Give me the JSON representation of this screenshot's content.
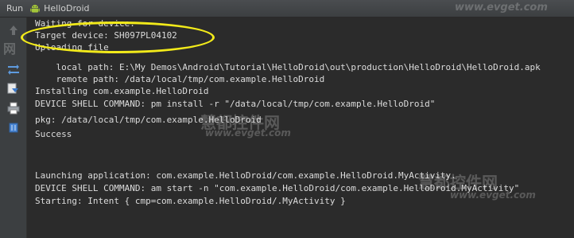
{
  "header": {
    "run_label": "Run",
    "config_name": "HelloDroid"
  },
  "toolbar": {
    "buttons": [
      {
        "icon": "up-arrow-icon"
      },
      {
        "icon": "rerun-icon"
      },
      {
        "icon": "scroll-to-end-icon"
      },
      {
        "icon": "print-icon"
      },
      {
        "icon": "clear-all-icon"
      }
    ]
  },
  "console": {
    "lines": [
      "Waiting for device.",
      "Target device: SH097PL04102",
      "Uploading file",
      "    local path: E:\\My Demos\\Android\\Tutorial\\HelloDroid\\out\\production\\HelloDroid\\HelloDroid.apk",
      "    remote path: /data/local/tmp/com.example.HelloDroid",
      "Installing com.example.HelloDroid",
      "DEVICE SHELL COMMAND: pm install -r \"/data/local/tmp/com.example.HelloDroid\"",
      "pkg: /data/local/tmp/com.example.HelloDroid",
      "Success",
      "",
      "",
      "Launching application: com.example.HelloDroid/com.example.HelloDroid.MyActivity.",
      "DEVICE SHELL COMMAND: am start -n \"com.example.HelloDroid/com.example.HelloDroid.MyActivity\"",
      "Starting: Intent { cmp=com.example.HelloDroid/.MyActivity }"
    ]
  },
  "highlight": {
    "color": "#f2ea1a"
  },
  "watermarks": {
    "url": "www.evget.com",
    "cn_short": "网",
    "cn_long": "慧都控件网"
  }
}
